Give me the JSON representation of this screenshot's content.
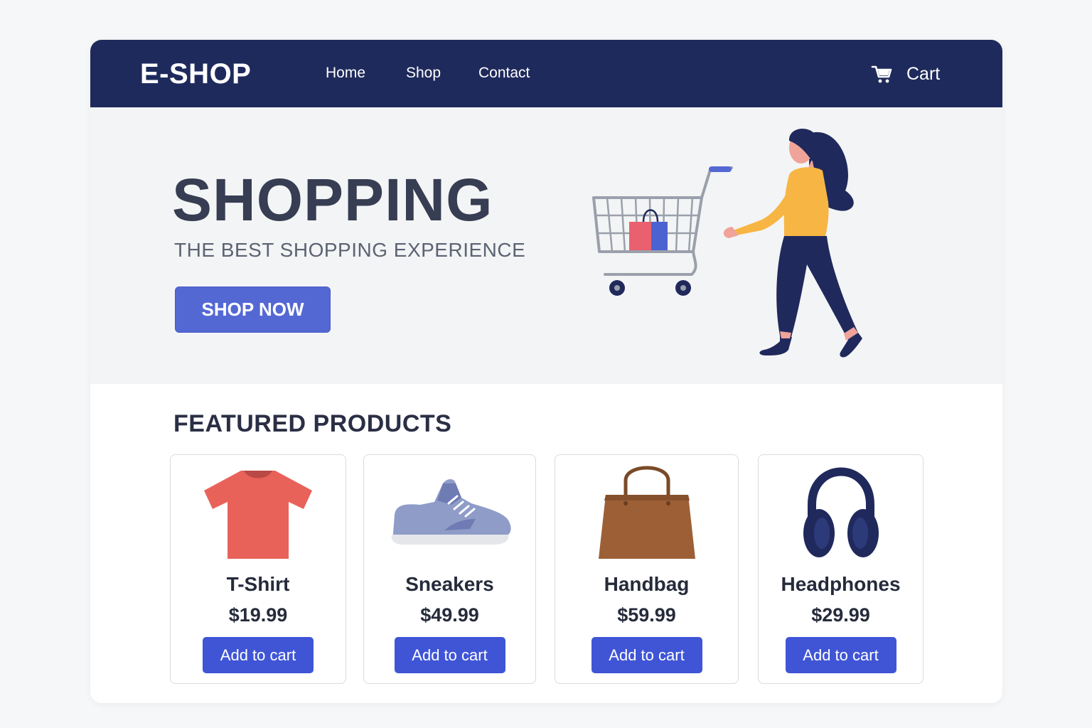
{
  "header": {
    "brand": "E-SHOP",
    "nav": [
      {
        "label": "Home"
      },
      {
        "label": "Shop"
      },
      {
        "label": "Contact"
      }
    ],
    "cart_label": "Cart",
    "cart_icon": "shopping-cart-icon",
    "background_color": "#1f2a5c"
  },
  "hero": {
    "title": "SHOPPING",
    "subtitle": "THE BEST SHOPPING EXPERIENCE",
    "cta_label": "SHOP NOW",
    "illustration": "woman-pushing-shopping-cart"
  },
  "featured": {
    "title": "FEATURED PRODUCTS",
    "products": [
      {
        "name": "T-Shirt",
        "price": "$19.99",
        "button": "Add to cart",
        "icon": "t-shirt-icon"
      },
      {
        "name": "Sneakers",
        "price": "$49.99",
        "button": "Add to cart",
        "icon": "sneaker-icon"
      },
      {
        "name": "Handbag",
        "price": "$59.99",
        "button": "Add to cart",
        "icon": "handbag-icon"
      },
      {
        "name": "Headphones",
        "price": "$29.99",
        "button": "Add to cart",
        "icon": "headphones-icon"
      }
    ]
  },
  "colors": {
    "accent": "#3f55d6",
    "navy": "#1f2a5c",
    "hero_background": "#f3f4f5"
  }
}
